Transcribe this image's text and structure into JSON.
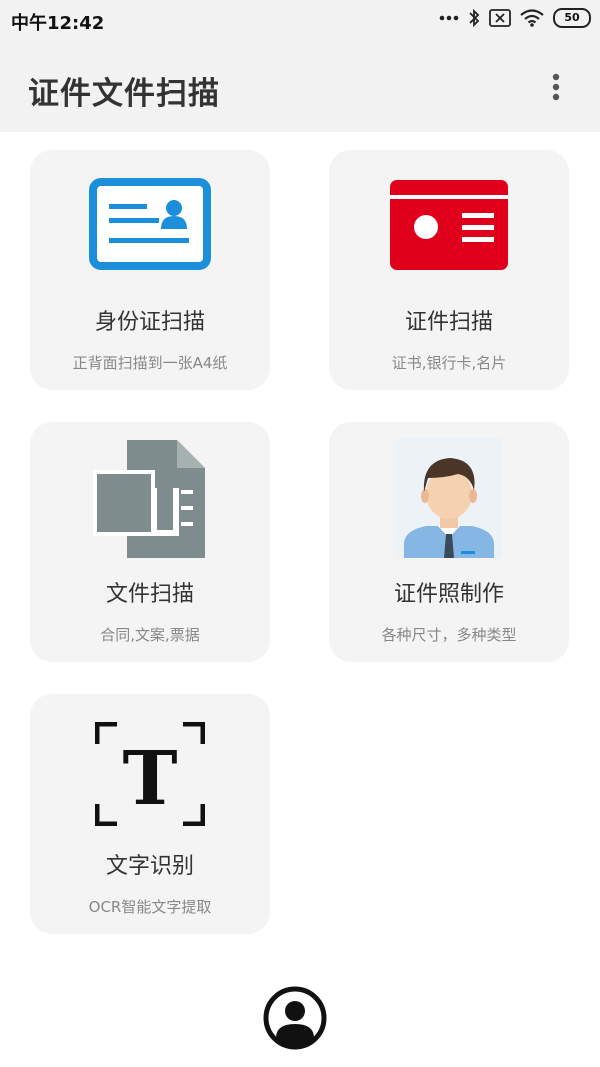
{
  "status": {
    "time": "中午12:42",
    "battery": "50"
  },
  "appbar": {
    "title": "证件文件扫描"
  },
  "cards": [
    {
      "title": "身份证扫描",
      "subtitle": "正背面扫描到一张A4纸",
      "icon": "id-card-icon"
    },
    {
      "title": "证件扫描",
      "subtitle": "证书,银行卡,名片",
      "icon": "red-card-icon"
    },
    {
      "title": "文件扫描",
      "subtitle": "合同,文案,票据",
      "icon": "document-icon"
    },
    {
      "title": "证件照制作",
      "subtitle": "各种尺寸，多种类型",
      "icon": "portrait-icon"
    },
    {
      "title": "文字识别",
      "subtitle": "OCR智能文字提取",
      "icon": "text-ocr-icon"
    }
  ],
  "colors": {
    "blue": "#1b8fdc",
    "red": "#e0001b",
    "gray": "#7f8c8d",
    "bar": "#f2f2f2",
    "card": "#f4f4f4"
  }
}
